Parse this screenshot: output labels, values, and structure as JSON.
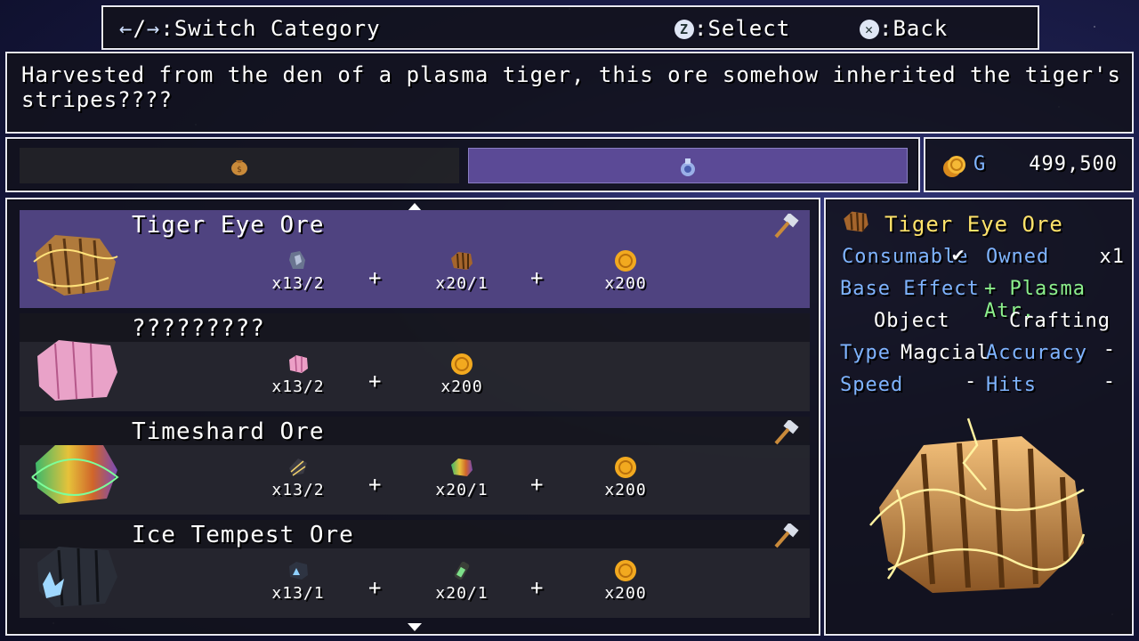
{
  "help": {
    "switch_label": "Switch Category",
    "select_key": "Z",
    "select_label": "Select",
    "back_key": "✕",
    "back_label": "Back",
    "left_arrow": "←",
    "sep": "/",
    "right_arrow": "→",
    "colon": ":"
  },
  "description": "Harvested from the den of a plasma tiger, this ore somehow inherited the tiger's stripes????",
  "categories": [
    {
      "icon": "money-bag-icon",
      "selected": false
    },
    {
      "icon": "potion-flask-icon",
      "selected": true
    }
  ],
  "gold": {
    "unit": "G",
    "amount": "499,500"
  },
  "list": {
    "rows": [
      {
        "name": "Tiger Eye Ore",
        "selected": true,
        "craftable": true,
        "ingredients": [
          {
            "icon": "ore-chunk-icon",
            "qty": "x13/2"
          },
          {
            "icon": "tiger-ore-icon",
            "qty": "x20/1"
          },
          {
            "icon": "gold-coin-icon",
            "qty": "x200"
          }
        ]
      },
      {
        "name": "?????????",
        "selected": false,
        "craftable": false,
        "ingredients": [
          {
            "icon": "pink-crystal-icon",
            "qty": "x13/2"
          },
          {
            "icon": "gold-coin-icon",
            "qty": "x200"
          }
        ]
      },
      {
        "name": "Timeshard Ore",
        "selected": false,
        "craftable": true,
        "ingredients": [
          {
            "icon": "wrapped-shard-icon",
            "qty": "x13/2"
          },
          {
            "icon": "rainbow-ore-icon",
            "qty": "x20/1"
          },
          {
            "icon": "gold-coin-icon",
            "qty": "x200"
          }
        ]
      },
      {
        "name": "Ice Tempest Ore",
        "selected": false,
        "craftable": true,
        "ingredients": [
          {
            "icon": "ice-ore-icon",
            "qty": "x13/1"
          },
          {
            "icon": "green-vial-icon",
            "qty": "x20/1"
          },
          {
            "icon": "gold-coin-icon",
            "qty": "x200"
          }
        ]
      }
    ],
    "plus": "+"
  },
  "detail": {
    "name": "Tiger Eye Ore",
    "consumable_label": "Consumable",
    "check": "✔",
    "owned_label": "Owned",
    "owned_value": "x1",
    "base_effect_label": "Base Effect",
    "base_effect_value": "+ Plasma Atr.",
    "object_label": "Object",
    "crafting_label": "Crafting",
    "type_label": "Type",
    "type_value": "Magcial",
    "accuracy_label": "Accuracy",
    "accuracy_value": "-",
    "speed_label": "Speed",
    "speed_value": "-",
    "hits_label": "Hits",
    "hits_value": "-"
  }
}
